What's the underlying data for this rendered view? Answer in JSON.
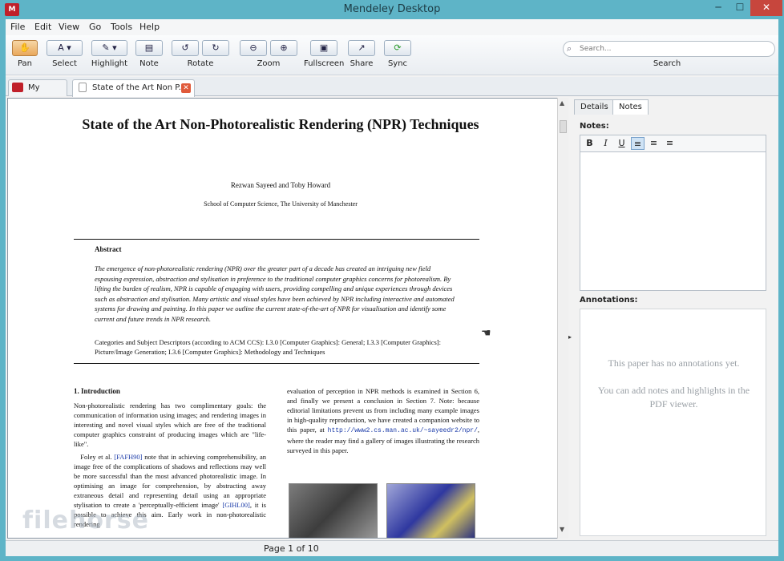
{
  "window": {
    "title": "Mendeley Desktop",
    "app_icon_text": "M",
    "min": "─",
    "max": "☐",
    "close": "✕"
  },
  "menu": [
    "File",
    "Edit",
    "View",
    "Go",
    "Tools",
    "Help"
  ],
  "toolbar": {
    "pan": "Pan",
    "select": "Select",
    "highlight": "Highlight",
    "note": "Note",
    "rotate": "Rotate",
    "zoom": "Zoom",
    "fullscreen": "Fullscreen",
    "share": "Share",
    "sync": "Sync",
    "search_label": "Search",
    "search_placeholder": "Search..."
  },
  "tabs": [
    {
      "label": "My Library"
    },
    {
      "label": "State of the Art Non P..."
    }
  ],
  "pdf": {
    "title": "State of the Art Non-Photorealistic Rendering (NPR) Techniques",
    "authors": "Rezwan Sayeed and Toby Howard",
    "affiliation": "School of Computer Science, The University of Manchester",
    "abstract_heading": "Abstract",
    "abstract": "The emergence of non-photorealistic rendering (NPR) over the greater part of a decade has created an intriguing new field espousing expression, abstraction and stylisation in preference to the traditional computer graphics concerns for photorealism. By lifting the burden of realism, NPR is capable of engaging with users, providing compelling and unique experiences through devices such as abstraction and stylisation. Many artistic and visual styles have been achieved by NPR including interactive and automated systems for drawing and painting. In this paper we outline the current state-of-the-art of NPR for visualisation and identify some current and future trends in NPR research.",
    "categories": "Categories and Subject Descriptors (according to ACM CCS): I.3.0 [Computer Graphics]: General; I.3.3 [Computer Graphics]: Picture/Image Generation; I.3.6 [Computer Graphics]: Methodology and Techniques",
    "intro_heading": "1.  Introduction",
    "intro_p1": "Non-photorealistic rendering has two complimentary goals: the communication of information using images; and rendering images in interesting and novel visual styles which are free of the traditional computer graphics constraint of producing images which are \"life-like\".",
    "intro_p2_a": "Foley et al. ",
    "intro_p2_cite1": "[FAFH90]",
    "intro_p2_b": " note that in achieving comprehensibility, an image free of the complications of shadows and reflections may well be more successful than the most advanced photorealistic image. In optimising an image for comprehension, by abstracting away extraneous detail and representing detail using an appropriate stylisation to create a 'perceptually-efficient image' ",
    "intro_p2_cite2": "[GIHL00]",
    "intro_p2_c": ", it is possible to achieve this aim. Early work in non-photorealistic rendering",
    "col2_a": "evaluation of perception in NPR methods is examined in Section 6, and finally we present a conclusion in Section 7. Note: because editorial limitations prevent us from including many example images in high-quality reproduction, we have created a companion website to this paper, at ",
    "col2_url": "http://www2.cs.man.ac.uk/~sayeedr2/npr/",
    "col2_b": ", where the reader may find a gallery of images illustrating the research surveyed in this paper."
  },
  "right_panel": {
    "tab_details": "Details",
    "tab_notes": "Notes",
    "notes_label": "Notes:",
    "bold": "B",
    "italic": "I",
    "underline": "U",
    "annotations_label": "Annotations:",
    "no_annotations": "This paper has no annotations yet.",
    "add_hint": "You can add notes and highlights in the PDF viewer."
  },
  "status": {
    "page": "Page 1 of 10"
  },
  "watermark": "filehorse",
  "colors": {
    "frame": "#5eb4c7",
    "close_button": "#c7463d",
    "active_tool": "#e9a85c"
  }
}
